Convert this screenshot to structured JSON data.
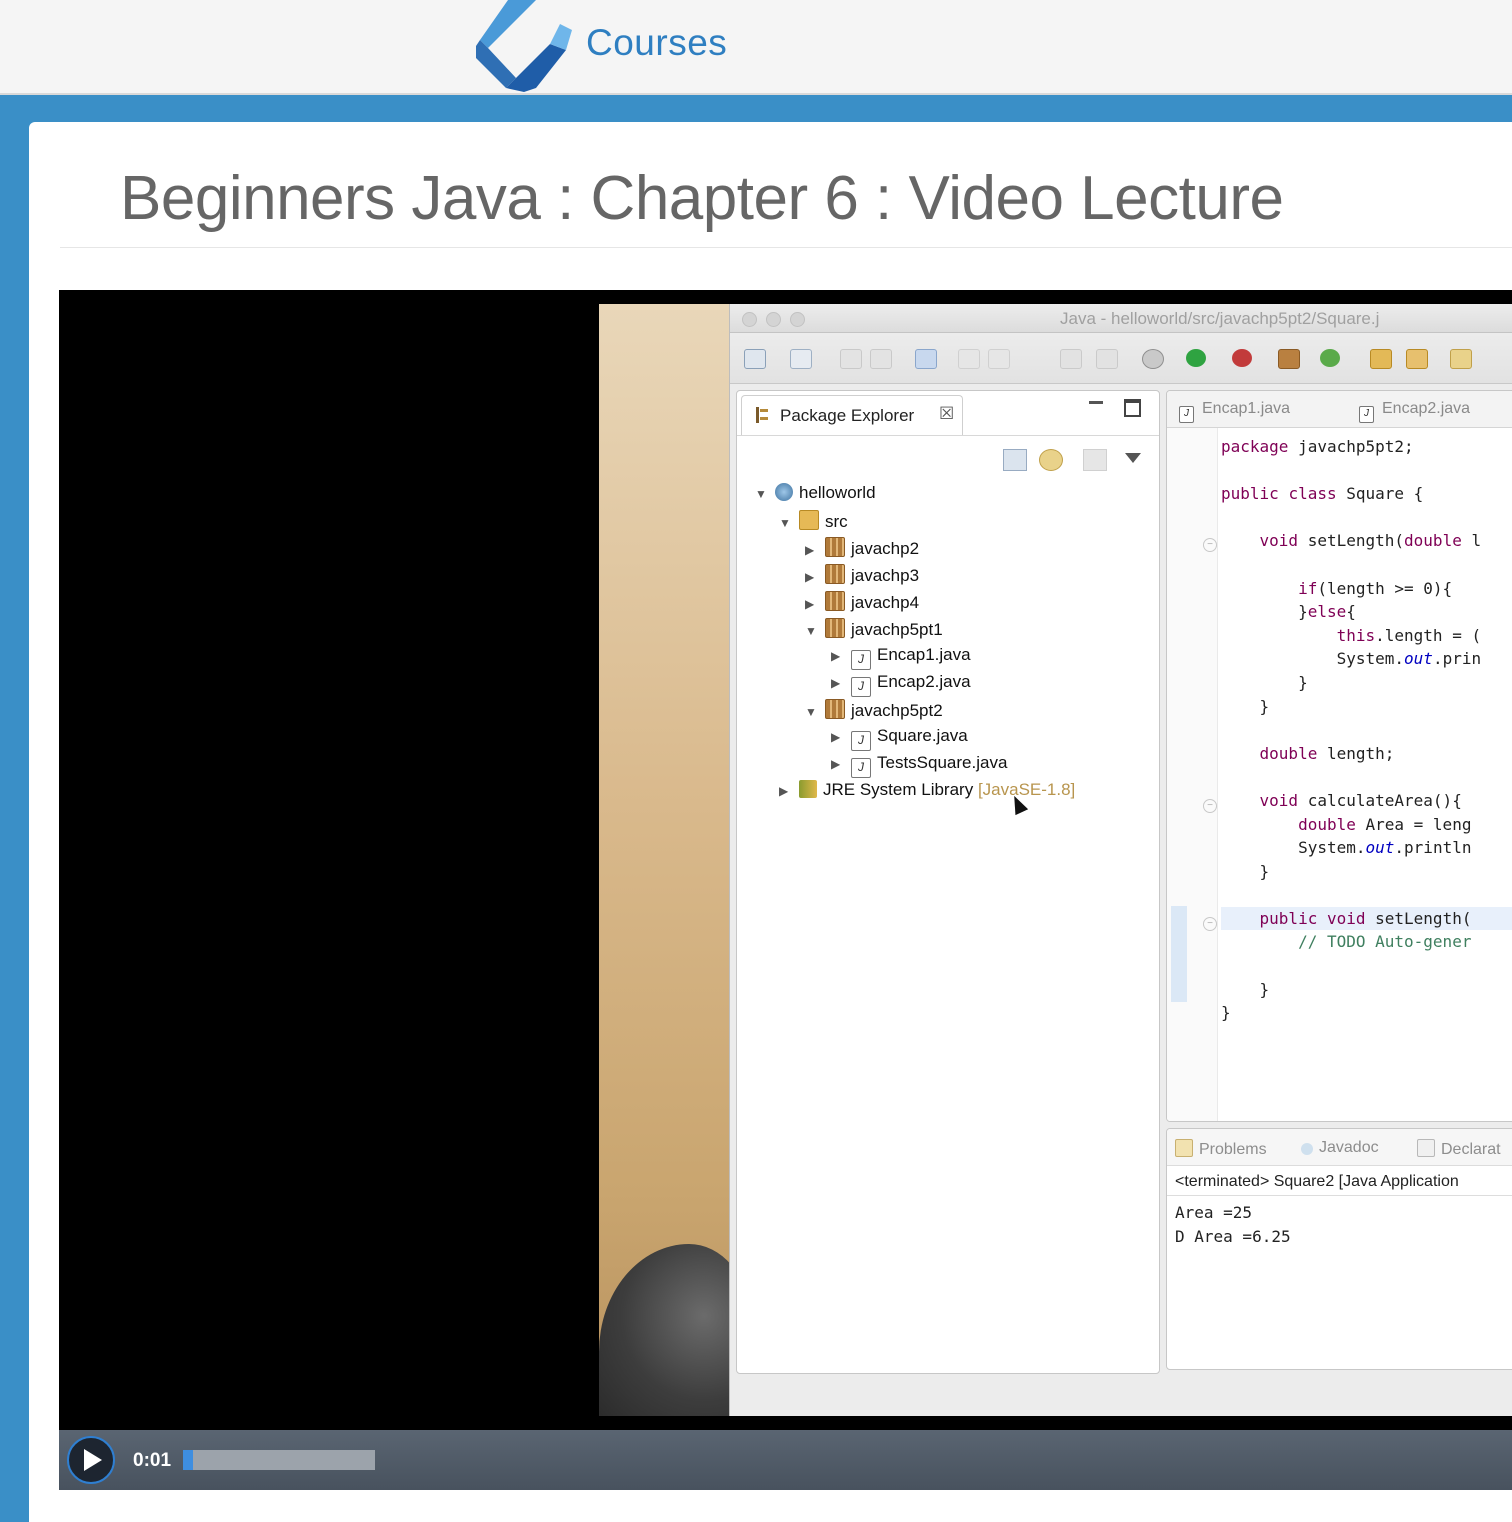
{
  "header": {
    "brand": "Courses",
    "logo_icon": "courses-logo-icon"
  },
  "page": {
    "title": "Beginners Java : Chapter 6 : Video Lecture"
  },
  "video": {
    "current_time": "0:01",
    "progress": 0.05,
    "play_icon": "play-icon"
  },
  "ide": {
    "window_title": "Java - helloworld/src/javachp5pt2/Square.j",
    "package_explorer": {
      "tab_label": "Package Explorer",
      "close_symbol": "☒",
      "tree": [
        {
          "label": "helloworld",
          "expanded": true,
          "kind": "project"
        },
        {
          "label": "src",
          "expanded": true,
          "kind": "source-folder"
        },
        {
          "label": "javachp2",
          "expanded": false,
          "kind": "package"
        },
        {
          "label": "javachp3",
          "expanded": false,
          "kind": "package"
        },
        {
          "label": "javachp4",
          "expanded": false,
          "kind": "package"
        },
        {
          "label": "javachp5pt1",
          "expanded": true,
          "kind": "package"
        },
        {
          "label": "Encap1.java",
          "expanded": false,
          "kind": "java-file"
        },
        {
          "label": "Encap2.java",
          "expanded": false,
          "kind": "java-file"
        },
        {
          "label": "javachp5pt2",
          "expanded": true,
          "kind": "package"
        },
        {
          "label": "Square.java",
          "expanded": false,
          "kind": "java-file"
        },
        {
          "label": "TestsSquare.java",
          "expanded": false,
          "kind": "java-file"
        },
        {
          "label": "JRE System Library",
          "suffix": "[JavaSE-1.8]",
          "expanded": false,
          "kind": "library"
        }
      ]
    },
    "editor": {
      "tabs": [
        "Encap1.java",
        "Encap2.java"
      ],
      "code_lines": [
        "package javachp5pt2;",
        "",
        "public class Square {",
        "",
        "    void setLength(double l",
        "",
        "        if(length >= 0){",
        "        }else{",
        "            this.length = (",
        "            System.out.prin",
        "        }",
        "    }",
        "",
        "    double length;",
        "",
        "    void calculateArea(){",
        "        double Area = leng",
        "        System.out.println",
        "    }",
        "",
        "    public void setLength(",
        "        // TODO Auto-gener",
        "",
        "    }",
        "}"
      ]
    },
    "console": {
      "tabs": [
        "Problems",
        "Javadoc",
        "Declarat"
      ],
      "status": "<terminated> Square2 [Java Application",
      "output": [
        "Area =25",
        "D Area =6.25"
      ]
    }
  }
}
